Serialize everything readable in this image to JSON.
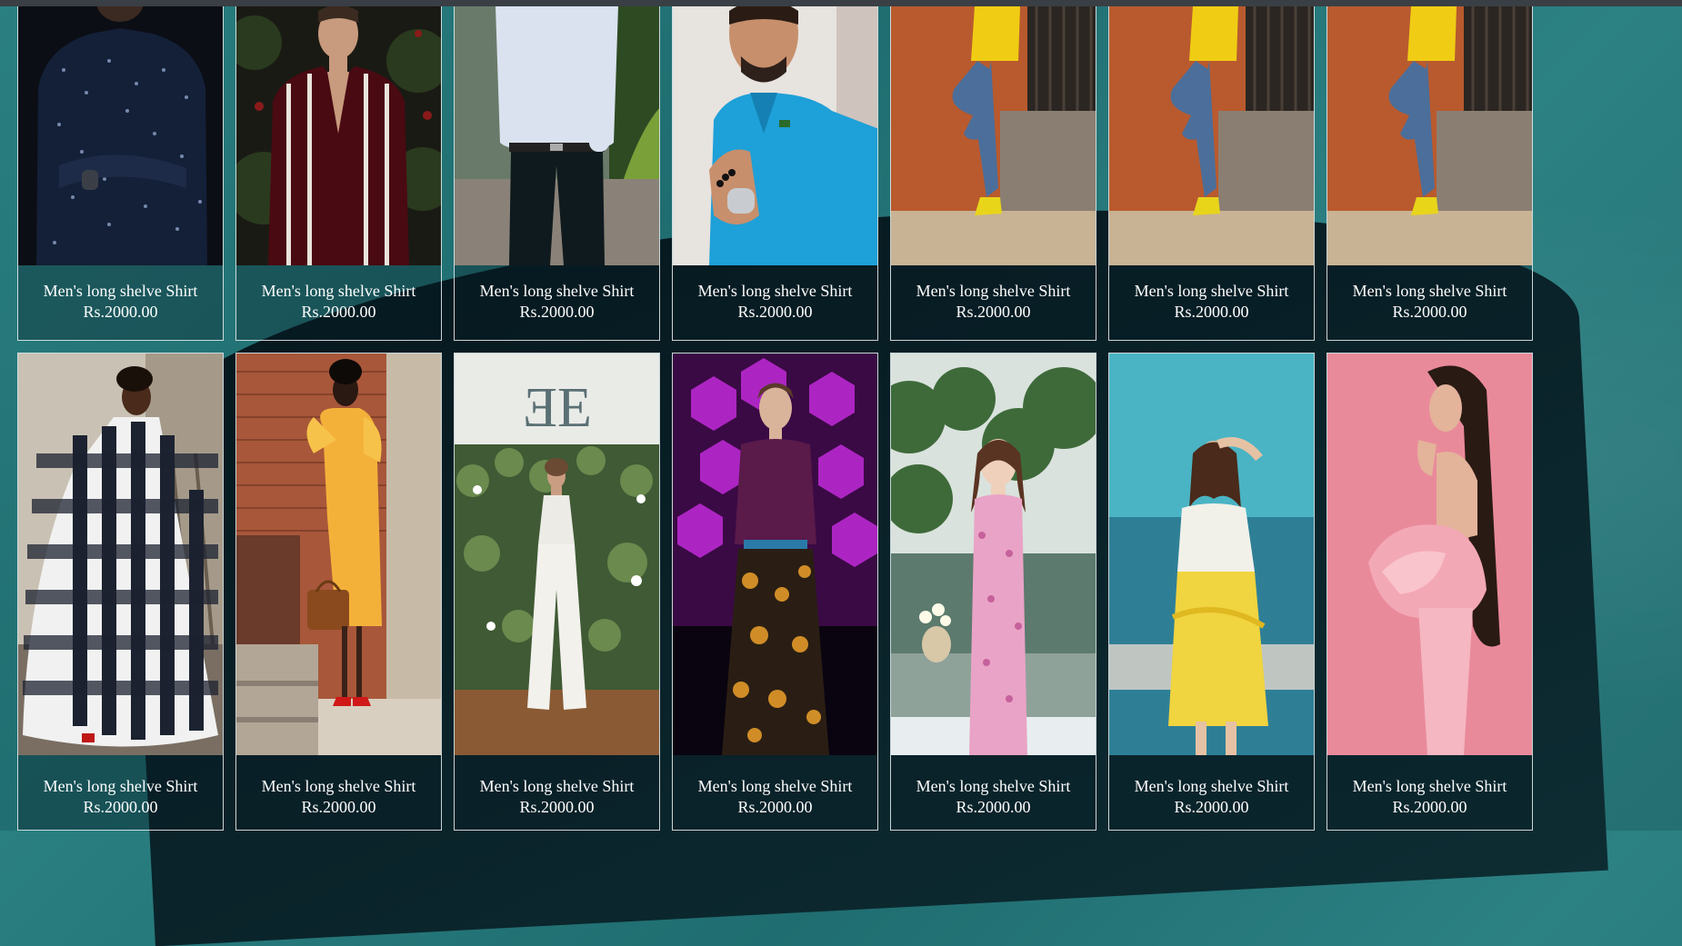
{
  "products": [
    {
      "name": "Men's long shelve Shirt",
      "price": "Rs.2000.00",
      "image": "man-navy-print-shirt"
    },
    {
      "name": "Men's long shelve Shirt",
      "price": "Rs.2000.00",
      "image": "man-striped-shirt"
    },
    {
      "name": "Men's long shelve Shirt",
      "price": "Rs.2000.00",
      "image": "man-white-shirt-black-pants"
    },
    {
      "name": "Men's long shelve Shirt",
      "price": "Rs.2000.00",
      "image": "man-blue-polo"
    },
    {
      "name": "Men's long shelve Shirt",
      "price": "Rs.2000.00",
      "image": "man-yellow-tee-orange-wall"
    },
    {
      "name": "Men's long shelve Shirt",
      "price": "Rs.2000.00",
      "image": "man-yellow-tee-orange-wall"
    },
    {
      "name": "Men's long shelve Shirt",
      "price": "Rs.2000.00",
      "image": "man-yellow-tee-orange-wall"
    },
    {
      "name": "Men's long shelve Shirt",
      "price": "Rs.2000.00",
      "image": "woman-gingham-dress"
    },
    {
      "name": "Men's long shelve Shirt",
      "price": "Rs.2000.00",
      "image": "woman-yellow-dress-brick"
    },
    {
      "name": "Men's long shelve Shirt",
      "price": "Rs.2000.00",
      "image": "woman-white-jumpsuit"
    },
    {
      "name": "Men's long shelve Shirt",
      "price": "Rs.2000.00",
      "image": "woman-purple-floral-runway"
    },
    {
      "name": "Men's long shelve Shirt",
      "price": "Rs.2000.00",
      "image": "woman-pink-ao-dai-lake"
    },
    {
      "name": "Men's long shelve Shirt",
      "price": "Rs.2000.00",
      "image": "woman-white-tee-yellow-skirt"
    },
    {
      "name": "Men's long shelve Shirt",
      "price": "Rs.2000.00",
      "image": "woman-pink-dress"
    }
  ],
  "colors": {
    "background": "#247476",
    "caption_text": "#ffffff",
    "card_border": "#ebf5f5"
  }
}
